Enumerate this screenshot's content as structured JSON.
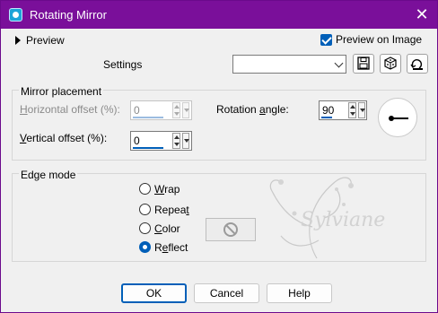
{
  "window": {
    "title": "Rotating Mirror"
  },
  "top": {
    "preview_toggle": "Preview",
    "preview_on_image": "Preview on Image",
    "preview_on_image_checked": true,
    "settings_label": "Settings",
    "settings_value": ""
  },
  "mirror": {
    "group_title": "Mirror placement",
    "h_offset_pre": "H",
    "h_offset_rest": "orizontal offset (%):",
    "h_offset_value": "0",
    "v_offset_pre": "V",
    "v_offset_rest": "ertical offset (%):",
    "v_offset_value": "0",
    "rotation_pre": "Rotation ",
    "rotation_mn": "a",
    "rotation_rest": "ngle:",
    "rotation_value": "90"
  },
  "edge": {
    "group_title": "Edge mode",
    "options": [
      {
        "pre": "",
        "mn": "W",
        "rest": "rap",
        "selected": false
      },
      {
        "pre": "Repea",
        "mn": "t",
        "rest": "",
        "selected": false
      },
      {
        "pre": "",
        "mn": "C",
        "rest": "olor",
        "selected": false
      },
      {
        "pre": "R",
        "mn": "e",
        "rest": "flect",
        "selected": true
      }
    ]
  },
  "buttons": {
    "ok": "OK",
    "cancel": "Cancel",
    "help": "Help"
  },
  "watermark": {
    "text": "Sylviane"
  },
  "colors": {
    "titlebar": "#7a0f9a",
    "accent": "#005fb8"
  }
}
